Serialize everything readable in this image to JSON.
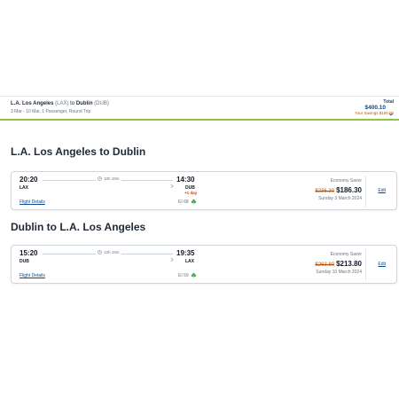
{
  "summary": {
    "origin": "L.A. Los Angeles",
    "origin_code": "(LAX)",
    "to_word": "to",
    "destination": "Dublin",
    "destination_code": "(DUB)",
    "meta": "3 Mar - 10 Mar, 1 Passenger, Round Trip",
    "total_label": "Total",
    "total_value": "$400.10",
    "savings": "Your Savings $100.00"
  },
  "outbound": {
    "title": "L.A. Los Angeles to Dublin",
    "dep_time": "20:20",
    "dep_code": "LAX",
    "duration": "10h 10m",
    "arr_time": "14:30",
    "arr_code": "DUB",
    "next_day": "+1 day",
    "flight_details": "Flight Details",
    "flight_number": "EI 68",
    "fare_class": "Economy Saver",
    "old_price": "$236.30",
    "price": "$186.30",
    "date": "Sunday 3 March 2024",
    "edit": "Edit"
  },
  "inbound": {
    "title": "Dublin to L.A. Los Angeles",
    "dep_time": "15:20",
    "dep_code": "DUB",
    "duration": "12h 15m",
    "arr_time": "19:35",
    "arr_code": "LAX",
    "flight_details": "Flight Details",
    "flight_number": "EI 59",
    "fare_class": "Economy Saver",
    "old_price": "$263.80",
    "price": "$213.80",
    "date": "Sunday 10 March 2024",
    "edit": "Edit"
  },
  "colors": {
    "accent_green": "#8cc63f",
    "link_blue": "#0b4a8a",
    "old_price_orange": "#b45309"
  },
  "icons": {
    "duration": "clock-icon",
    "airline": "shamrock-icon",
    "total_toggle": "chevron-down-icon"
  }
}
